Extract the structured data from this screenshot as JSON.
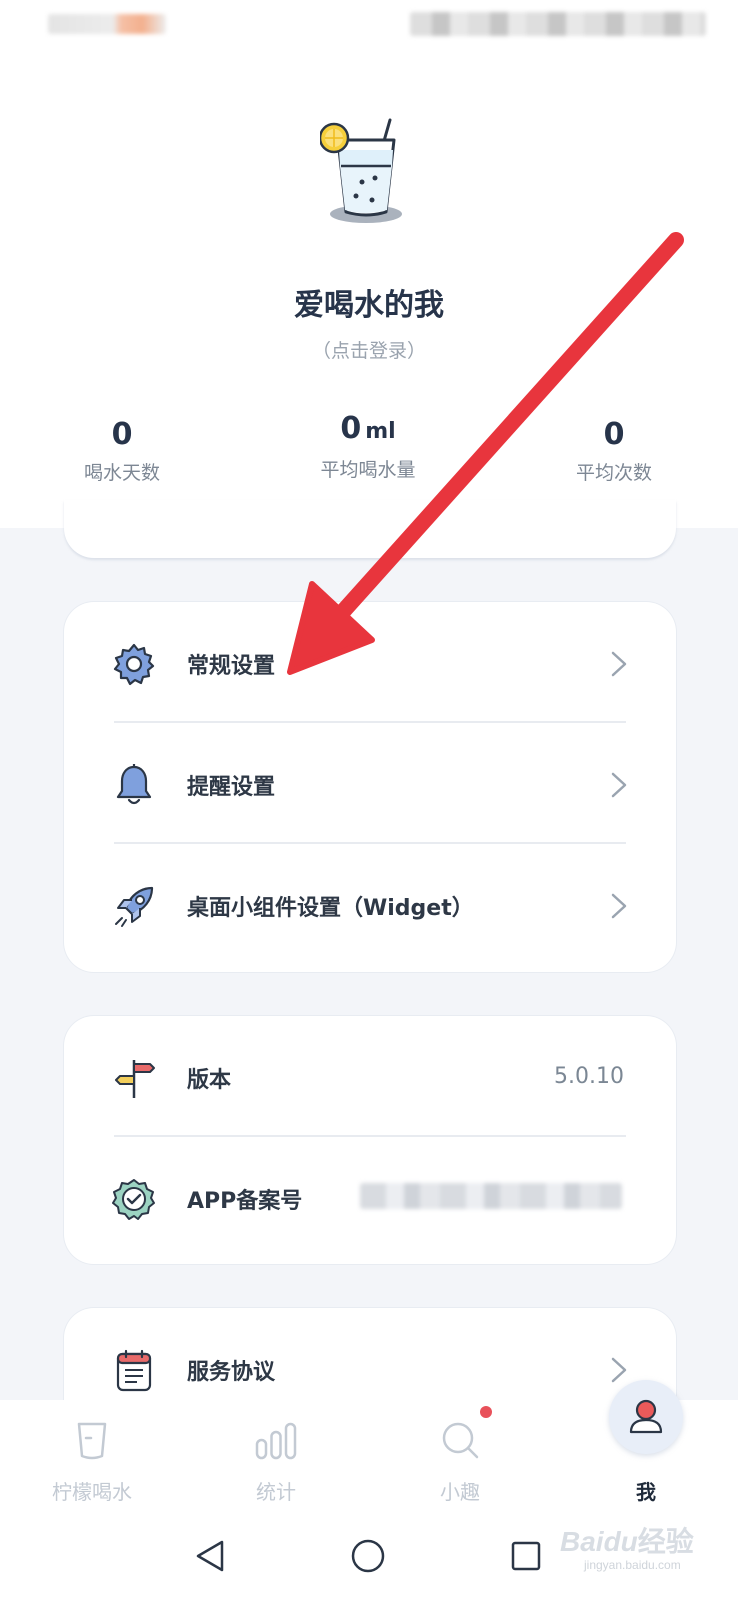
{
  "profile": {
    "name": "爱喝水的我",
    "login_hint": "（点击登录）"
  },
  "stats": [
    {
      "value": "0",
      "unit": "",
      "label": "喝水天数"
    },
    {
      "value": "0",
      "unit": "ml",
      "label": "平均喝水量"
    },
    {
      "value": "0",
      "unit": "",
      "label": "平均次数"
    }
  ],
  "settings_card": {
    "items": [
      {
        "label": "常规设置",
        "icon": "gear-icon"
      },
      {
        "label": "提醒设置",
        "icon": "bell-icon"
      },
      {
        "label": "桌面小组件设置（Widget）",
        "icon": "rocket-icon"
      }
    ]
  },
  "info_card": {
    "version_label": "版本",
    "version_value": "5.0.10",
    "record_label": "APP备案号",
    "record_value_blurred": true
  },
  "service_card": {
    "label": "服务协议",
    "icon": "document-icon"
  },
  "bottom_nav": [
    {
      "label": "柠檬喝水",
      "icon": "cup-icon",
      "active": false
    },
    {
      "label": "统计",
      "icon": "bar-chart-icon",
      "active": false
    },
    {
      "label": "小趣",
      "icon": "search-icon",
      "active": false,
      "badge": true
    },
    {
      "label": "我",
      "icon": "person-icon",
      "active": true
    }
  ],
  "watermark": {
    "text": "Bai",
    "text2": "du",
    "text3": "经验",
    "sub": "jingyan.baidu.com"
  },
  "colors": {
    "accent_red": "#e8353d",
    "icon_blue": "#6f93d6",
    "background": "#f3f5f9",
    "text_dark": "#27344a"
  }
}
